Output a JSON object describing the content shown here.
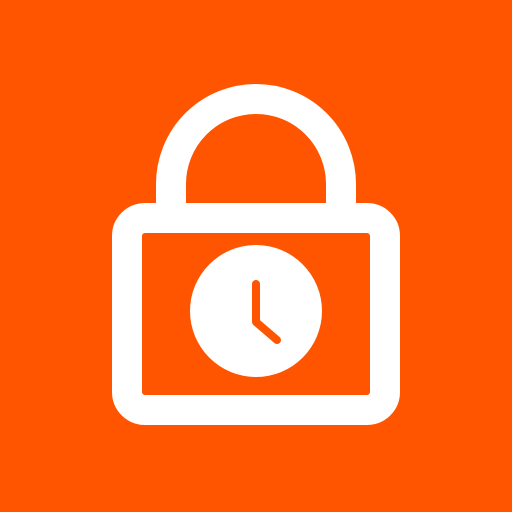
{
  "app_icon": {
    "icon": "lock-clock-icon",
    "components": {
      "padlock": "padlock-icon",
      "clock": "clock-icon"
    },
    "colors": {
      "background": "#ff5500",
      "foreground": "#ffffff",
      "clock_hands": "#ff5500"
    }
  }
}
